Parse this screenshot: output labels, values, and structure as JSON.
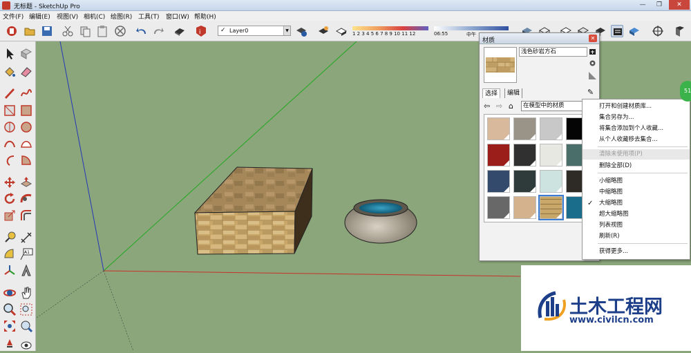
{
  "window": {
    "title": "无标题 - SketchUp Pro",
    "controls": {
      "minimize": "—",
      "restore": "❐",
      "close": "✕"
    }
  },
  "menu": {
    "items": [
      "文件(F)",
      "编辑(E)",
      "视图(V)",
      "相机(C)",
      "绘图(R)",
      "工具(T)",
      "窗口(W)",
      "帮助(H)"
    ]
  },
  "toolbar": {
    "layer": {
      "check": "✓",
      "value": "Layer0"
    },
    "shadow_scale": "1 2 3 4 5 6 7 8 9 10 11 12",
    "time_start": "06:55",
    "time_mid": "中午"
  },
  "materials_panel": {
    "title": "材质",
    "close_label": "✕",
    "material_name": "浅色砂岩方石",
    "tabs": [
      "选择",
      "编辑"
    ],
    "collection": "在模型中的材质",
    "swatches": [
      {
        "color": "#d9b99b",
        "selected": false
      },
      {
        "color": "#9a9488",
        "selected": false
      },
      {
        "color": "#c8c8c8",
        "selected": false
      },
      {
        "color": "#050505",
        "selected": false
      },
      {
        "color": "#9b1e1a",
        "selected": false
      },
      {
        "color": "#303030",
        "selected": false
      },
      {
        "color": "#e8e8e2",
        "selected": false
      },
      {
        "color": "#4a6e6a",
        "selected": false
      },
      {
        "color": "#344a6c",
        "selected": false
      },
      {
        "color": "#2f3a3a",
        "selected": false
      },
      {
        "color": "#cde3df",
        "selected": false
      },
      {
        "color": "#2e2a26",
        "selected": false
      },
      {
        "color": "#686868",
        "selected": false
      },
      {
        "color": "#d4b28e",
        "selected": false
      },
      {
        "color": "#c9a769",
        "selected": true
      },
      {
        "color": "#1a6e8c",
        "selected": false
      }
    ]
  },
  "context_menu": {
    "items": [
      {
        "label": "打开和创建材质库...",
        "disabled": false,
        "checked": false
      },
      {
        "label": "集合另存为...",
        "disabled": false,
        "checked": false
      },
      {
        "label": "将集合添加到个人收藏...",
        "disabled": false,
        "checked": false
      },
      {
        "label": "从个人收藏移去集合...",
        "disabled": false,
        "checked": false
      },
      {
        "label": "清除未使用项(P)",
        "disabled": true,
        "checked": false
      },
      {
        "label": "删除全部(D)",
        "disabled": false,
        "checked": false
      },
      {
        "label": "小缩略图",
        "disabled": false,
        "checked": false
      },
      {
        "label": "中缩略图",
        "disabled": false,
        "checked": false
      },
      {
        "label": "大缩略图",
        "disabled": false,
        "checked": true
      },
      {
        "label": "超大缩略图",
        "disabled": false,
        "checked": false
      },
      {
        "label": "列表视图",
        "disabled": false,
        "checked": false
      },
      {
        "label": "刷新(R)",
        "disabled": false,
        "checked": false
      },
      {
        "label": "获得更多...",
        "disabled": false,
        "checked": false
      }
    ]
  },
  "side_badge": "51",
  "watermark": {
    "title": "土木工程网",
    "url": "www.civilcn.com"
  }
}
